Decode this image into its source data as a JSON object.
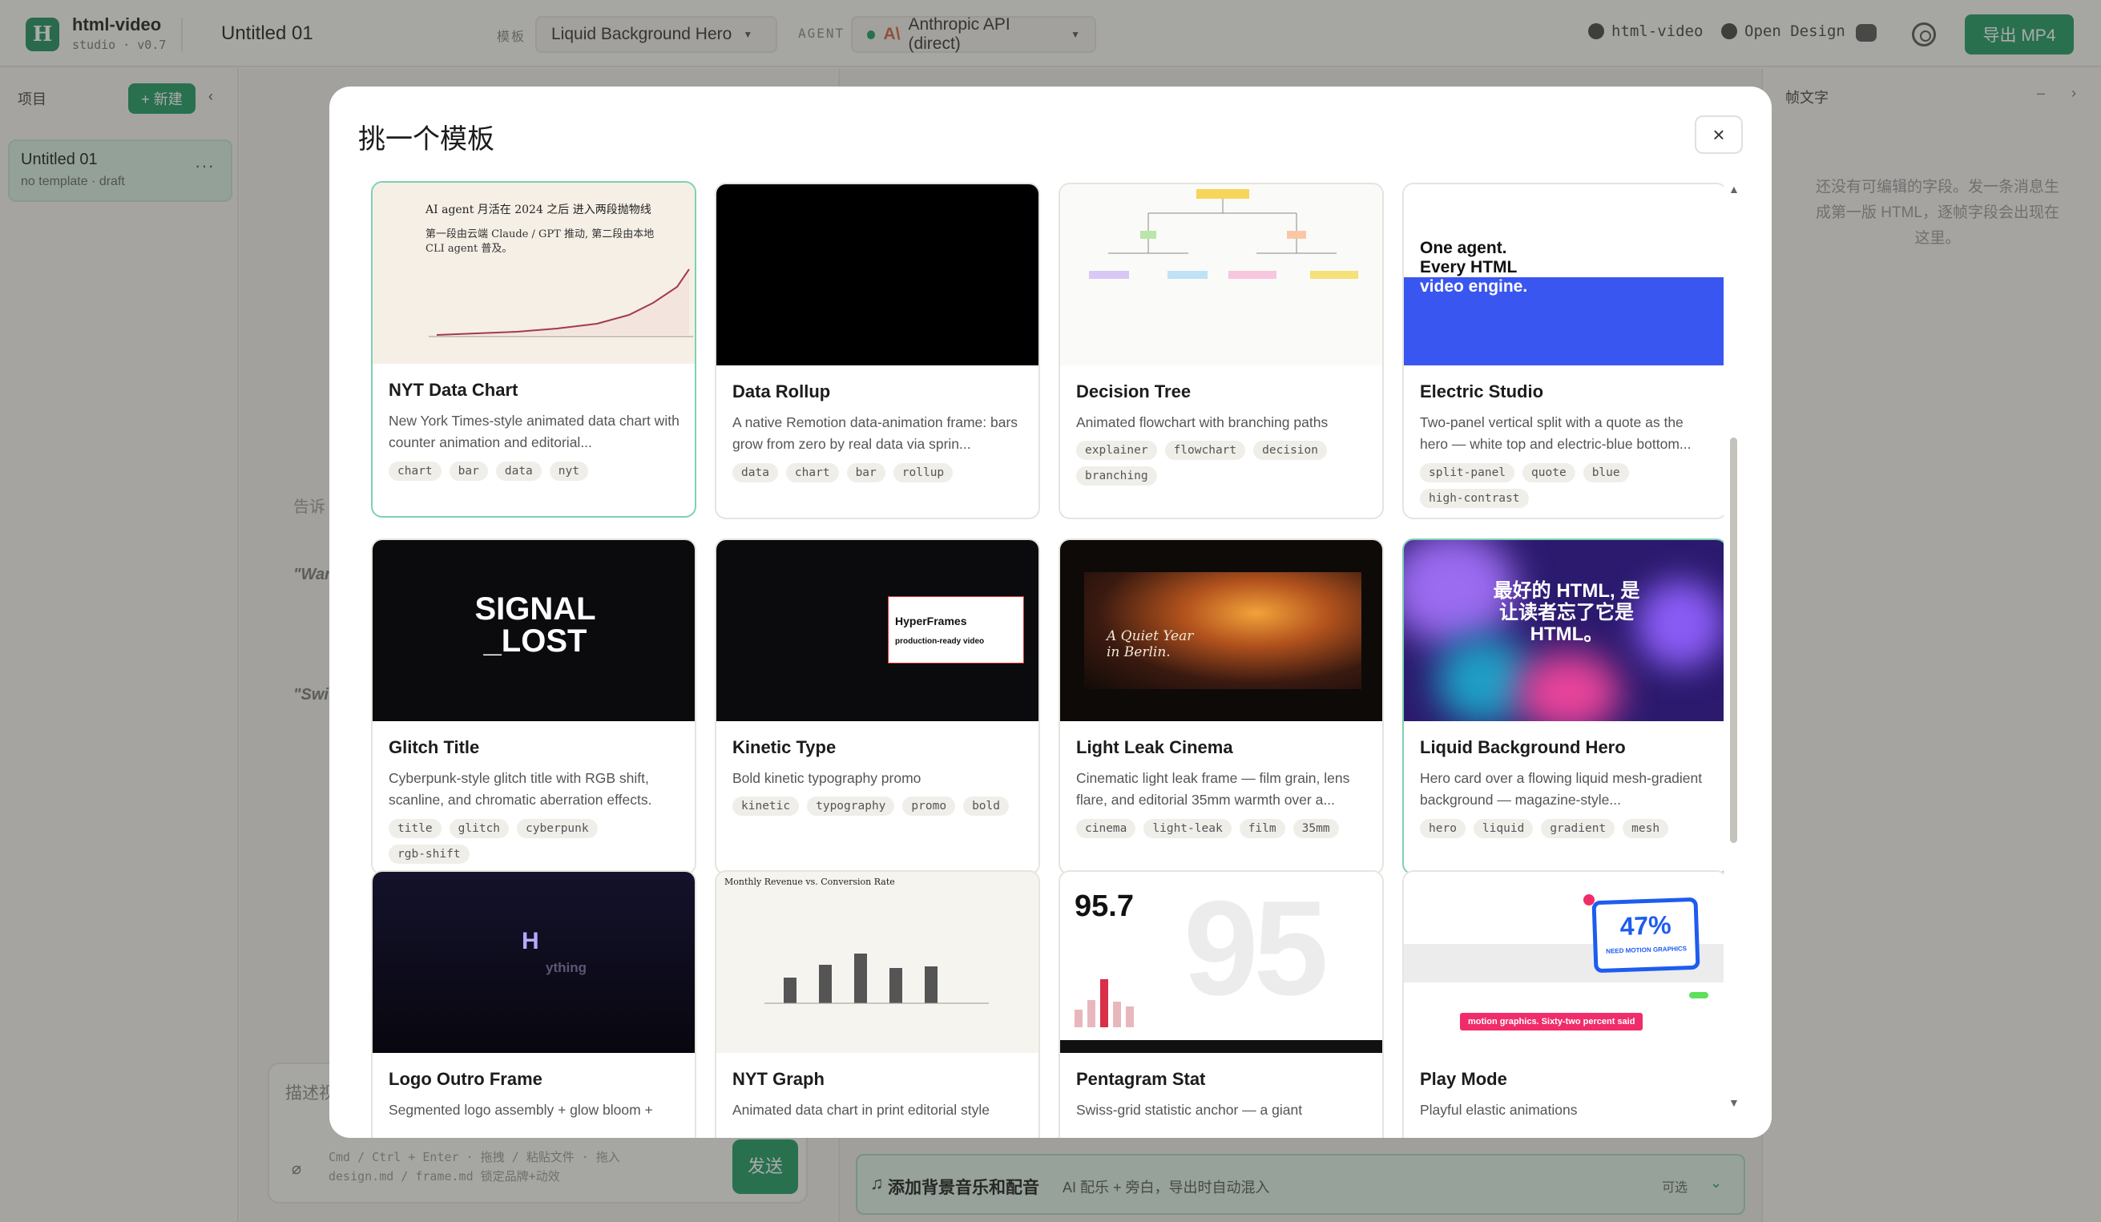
{
  "app": {
    "name": "html-video",
    "version": "studio · v0.7",
    "logo_letter": "H",
    "project_title": "Untitled 01",
    "template_label": "模板",
    "template_value": "Liquid Background Hero",
    "agent_label": "AGENT",
    "agent_value": "Anthropic API (direct)",
    "agent_mark": "A\\",
    "links": [
      "html-video",
      "Open Design"
    ],
    "export_label": "导出 MP4"
  },
  "sidebar": {
    "label": "项目",
    "new_label": "+ 新建",
    "collapse": "‹",
    "project": {
      "name": "Untitled 01",
      "meta": "no template · draft",
      "more": "···"
    }
  },
  "center": {
    "hint": "告诉",
    "quote1": "\"War",
    "quote2": "\"Swi",
    "compose_placeholder": "描述视",
    "compose_help": "Cmd / Ctrl + Enter · 拖拽 / 粘贴文件 · 拖入 design.md / frame.md 锁定品牌+动效",
    "send_label": "发送"
  },
  "music": {
    "title": "添加背景音乐和配音",
    "subtitle": "AI 配乐 + 旁白，导出时自动混入",
    "optional": "可选"
  },
  "right_panel": {
    "title": "帧文字",
    "controls": "– ›",
    "empty": "还没有可编辑的字段。发一条消息生成第一版 HTML，逐帧字段会出现在这里。"
  },
  "modal": {
    "title": "挑一个模板",
    "close": "×",
    "cards": [
      {
        "name": "NYT Data Chart",
        "desc": "New York Times-style animated data chart with counter animation and editorial...",
        "tags": [
          "chart",
          "bar",
          "data",
          "nyt"
        ],
        "thumb": {
          "headline": "AI agent 月活在 2024 之后 进入两段抛物线",
          "sub": "第一段由云端 Claude / GPT 推动, 第二段由本地 CLI agent 普及。"
        }
      },
      {
        "name": "Data Rollup",
        "desc": "A native Remotion data-animation frame: bars grow from zero by real data via sprin...",
        "tags": [
          "data",
          "chart",
          "bar",
          "rollup"
        ]
      },
      {
        "name": "Decision Tree",
        "desc": "Animated flowchart with branching paths",
        "tags": [
          "explainer",
          "flowchart",
          "decision",
          "branching"
        ]
      },
      {
        "name": "Electric Studio",
        "desc": "Two-panel vertical split with a quote as the hero — white top and electric-blue bottom...",
        "tags": [
          "split-panel",
          "quote",
          "blue",
          "high-contrast"
        ],
        "thumb": {
          "line1": "One agent.",
          "line2": "Every HTML",
          "line3": "video engine."
        }
      },
      {
        "name": "Glitch Title",
        "desc": "Cyberpunk-style glitch title with RGB shift, scanline, and chromatic aberration effects.",
        "tags": [
          "title",
          "glitch",
          "cyberpunk",
          "rgb-shift"
        ],
        "thumb": {
          "line1": "SIGNAL",
          "line2": "_LOST"
        }
      },
      {
        "name": "Kinetic Type",
        "desc": "Bold kinetic typography promo",
        "tags": [
          "kinetic",
          "typography",
          "promo",
          "bold"
        ],
        "thumb": {
          "line1": "HyperFrames",
          "line2": "production-ready video"
        }
      },
      {
        "name": "Light Leak Cinema",
        "desc": "Cinematic light leak frame — film grain, lens flare, and editorial 35mm warmth over a...",
        "tags": [
          "cinema",
          "light-leak",
          "film",
          "35mm"
        ],
        "thumb": {
          "line1": "A Quiet Year",
          "line2": "in Berlin."
        }
      },
      {
        "name": "Liquid Background Hero",
        "desc": "Hero card over a flowing liquid mesh-gradient background — magazine-style...",
        "tags": [
          "hero",
          "liquid",
          "gradient",
          "mesh"
        ],
        "thumb": {
          "line1": "最好的 HTML, 是",
          "line2": "让读者忘了它是",
          "line3": "HTML。"
        }
      },
      {
        "name": "Logo Outro Frame",
        "desc": "Segmented logo assembly + glow bloom +",
        "tags": [],
        "thumb": {
          "mark": "H",
          "word": "ything"
        }
      },
      {
        "name": "NYT Graph",
        "desc": "Animated data chart in print editorial style",
        "tags": [],
        "thumb": {
          "title": "Monthly Revenue vs. Conversion Rate"
        }
      },
      {
        "name": "Pentagram Stat",
        "desc": "Swiss-grid statistic anchor — a giant",
        "tags": [],
        "thumb": {
          "value": "95.7",
          "big": "95"
        }
      },
      {
        "name": "Play Mode",
        "desc": "Playful elastic animations",
        "tags": [],
        "thumb": {
          "value": "47%",
          "label": "NEED MOTION GRAPHICS",
          "banner": "motion graphics. Sixty-two percent said"
        }
      }
    ]
  },
  "colors": {
    "accent": "#1f9a62",
    "selected_border": "#7fd1ae",
    "electric_blue": "#3a56f0"
  },
  "icons": [
    "logo-icon",
    "github-icon",
    "discord-icon",
    "gear-icon",
    "close-icon",
    "attach-icon",
    "music-icon",
    "chevron-down-icon"
  ]
}
